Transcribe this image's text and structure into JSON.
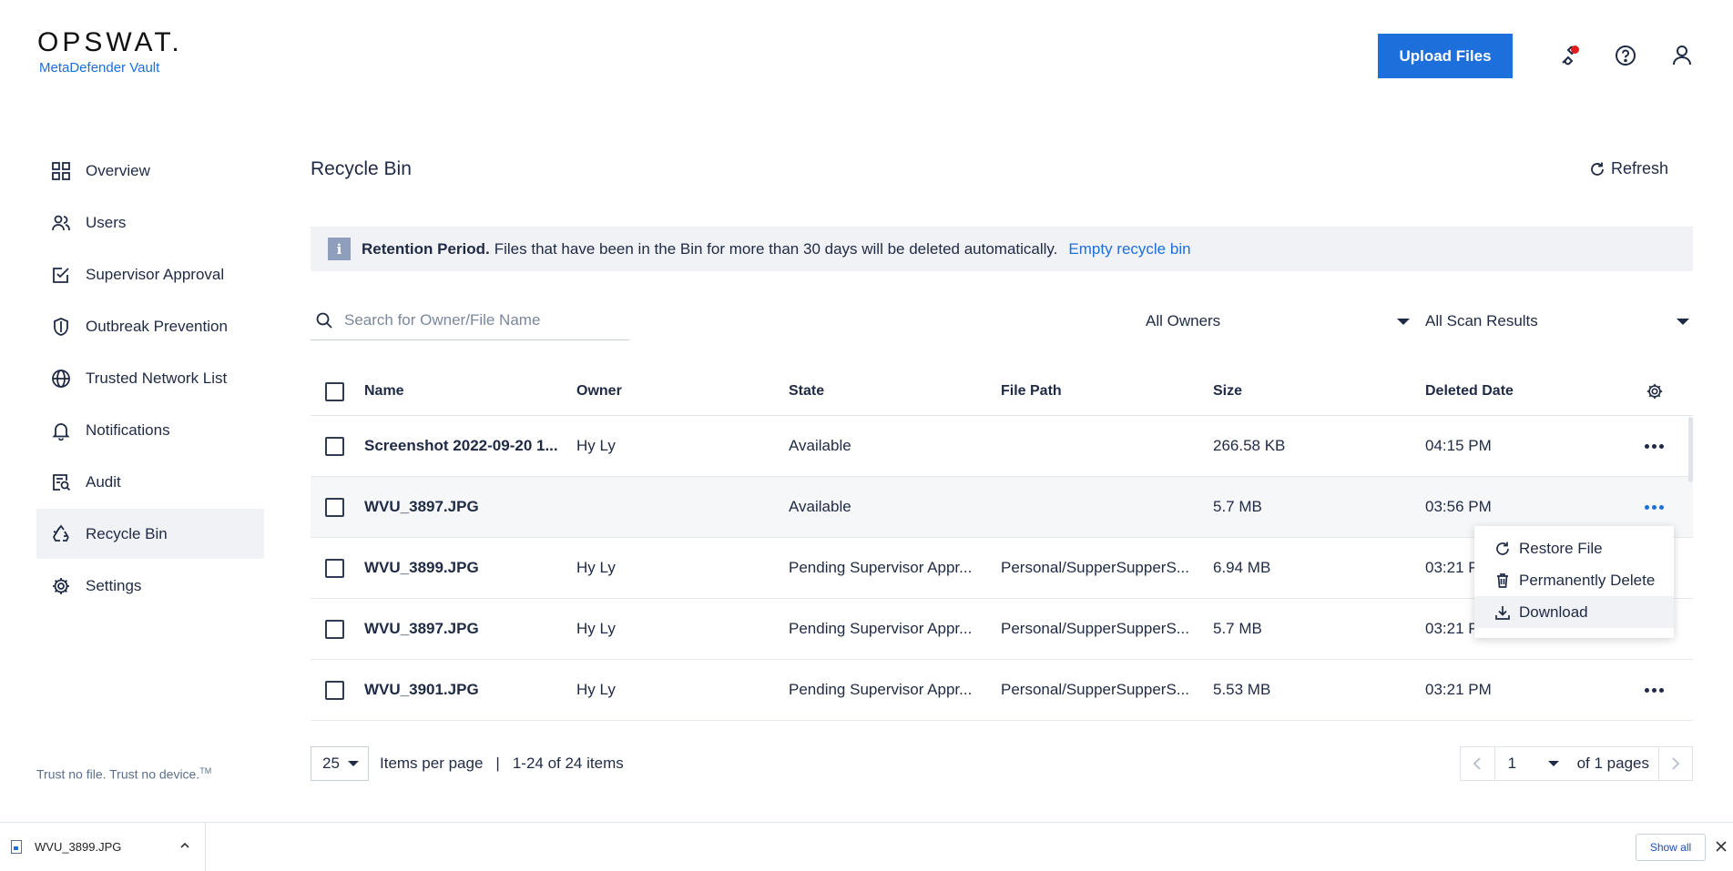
{
  "header": {
    "logo": "OPSWAT.",
    "product": "MetaDefender Vault",
    "upload_label": "Upload Files"
  },
  "sidebar": {
    "items": [
      {
        "label": "Overview",
        "icon": "grid-icon"
      },
      {
        "label": "Users",
        "icon": "users-icon"
      },
      {
        "label": "Supervisor Approval",
        "icon": "approval-icon"
      },
      {
        "label": "Outbreak Prevention",
        "icon": "shield-icon"
      },
      {
        "label": "Trusted Network List",
        "icon": "globe-icon"
      },
      {
        "label": "Notifications",
        "icon": "bell-icon"
      },
      {
        "label": "Audit",
        "icon": "audit-icon"
      },
      {
        "label": "Recycle Bin",
        "icon": "recycle-icon",
        "active": true
      },
      {
        "label": "Settings",
        "icon": "gear-icon"
      }
    ],
    "tagline": "Trust no file. Trust no device.",
    "tagline_tm": "TM"
  },
  "main": {
    "title": "Recycle Bin",
    "refresh_label": "Refresh",
    "banner": {
      "icon_letter": "i",
      "bold": "Retention Period.",
      "text": "Files that have been in the Bin for more than 30 days will be deleted automatically.",
      "link": "Empty recycle bin"
    },
    "search_placeholder": "Search for Owner/File Name",
    "filters": {
      "owners": "All Owners",
      "scan": "All Scan Results"
    },
    "columns": {
      "name": "Name",
      "owner": "Owner",
      "state": "State",
      "path": "File Path",
      "size": "Size",
      "date": "Deleted Date"
    },
    "rows": [
      {
        "name": "Screenshot 2022-09-20 1...",
        "owner": "Hy Ly",
        "state": "Available",
        "path": "",
        "size": "266.58 KB",
        "date": "04:15 PM"
      },
      {
        "name": "WVU_3897.JPG",
        "owner": "",
        "state": "Available",
        "path": "",
        "size": "5.7 MB",
        "date": "03:56 PM"
      },
      {
        "name": "WVU_3899.JPG",
        "owner": "Hy Ly",
        "state": "Pending Supervisor Appr...",
        "path": "Personal/SupperSupperS...",
        "size": "6.94 MB",
        "date": "03:21 PM"
      },
      {
        "name": "WVU_3897.JPG",
        "owner": "Hy Ly",
        "state": "Pending Supervisor Appr...",
        "path": "Personal/SupperSupperS...",
        "size": "5.7 MB",
        "date": "03:21 PM"
      },
      {
        "name": "WVU_3901.JPG",
        "owner": "Hy Ly",
        "state": "Pending Supervisor Appr...",
        "path": "Personal/SupperSupperS...",
        "size": "5.53 MB",
        "date": "03:21 PM"
      }
    ],
    "context_menu": {
      "restore": "Restore File",
      "delete": "Permanently Delete",
      "download": "Download"
    },
    "pagination": {
      "per_page": "25",
      "per_page_label": "Items per page",
      "separator": "|",
      "range": "1-24 of 24 items",
      "current_page": "1",
      "of_pages": "of 1 pages"
    }
  },
  "download_bar": {
    "file": "WVU_3899.JPG",
    "show_all": "Show all"
  },
  "colors": {
    "accent": "#1d6fdc",
    "text": "#1f2a44",
    "notification": "#e11c1c",
    "banner_bg": "#f0f2f5"
  }
}
